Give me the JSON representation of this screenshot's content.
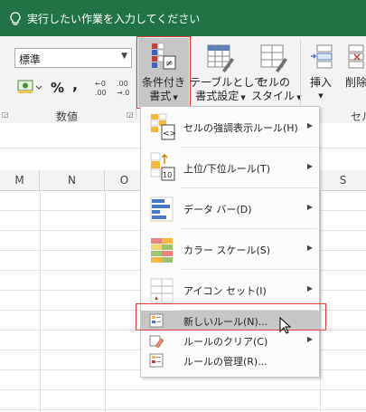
{
  "tell_me": {
    "text": "実行したい作業を入力してください"
  },
  "ribbon": {
    "number_format": "標準",
    "number_group_label": "数値",
    "conditional_formatting_line1": "条件付き",
    "conditional_formatting_line2": "書式",
    "format_as_table_line1": "テーブルとして",
    "format_as_table_line2": "書式設定",
    "cell_styles_line1": "セルの",
    "cell_styles_line2": "スタイル",
    "insert_label": "挿入",
    "delete_label": "削除",
    "cells_group_label": "セル",
    "percent_symbol": "%",
    "comma_symbol": ",",
    "increase_decimal": ".00",
    "decrease_decimal": "→.0"
  },
  "columns": [
    "M",
    "N",
    "O",
    "S"
  ],
  "menu": {
    "items": [
      {
        "label": "セルの強調表示ルール(H)",
        "submenu": true
      },
      {
        "label": "上位/下位ルール(T)",
        "submenu": true
      },
      {
        "label": "データ バー(D)",
        "submenu": true
      },
      {
        "label": "カラー スケール(S)",
        "submenu": true
      },
      {
        "label": "アイコン セット(I)",
        "submenu": true
      },
      {
        "label": "新しいルール(N)...",
        "submenu": false,
        "highlighted": true
      },
      {
        "label": "ルールのクリア(C)",
        "submenu": true
      },
      {
        "label": "ルールの管理(R)...",
        "submenu": false
      }
    ],
    "top_rules_icon_number": "10",
    "submenu_arrow": "▶"
  },
  "colors": {
    "tellbar": "#217346",
    "highlight": "#c6c6c6",
    "annotation_red": "#e03a3a"
  }
}
